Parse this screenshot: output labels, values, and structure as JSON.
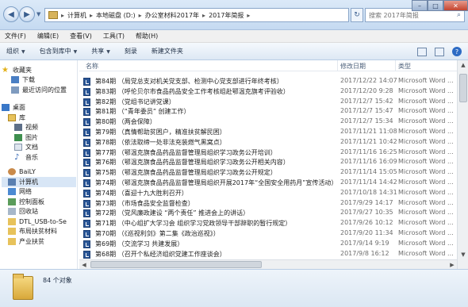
{
  "window": {
    "breadcrumbs": [
      "计算机",
      "本地磁盘 (D:)",
      "办公室材料2017年",
      "2017年简报"
    ],
    "search_placeholder": "搜索 2017年简报"
  },
  "menubar": [
    "文件(F)",
    "编辑(E)",
    "查看(V)",
    "工具(T)",
    "帮助(H)"
  ],
  "commandbar": {
    "organize": "组织",
    "include_in_library": "包含到库中",
    "share": "共享",
    "burn": "刻录",
    "new_folder": "新建文件夹"
  },
  "sidebar": {
    "favorites": {
      "label": "收藏夹",
      "items": [
        "下载",
        "最近访问的位置"
      ]
    },
    "desktop": "桌面",
    "libraries": {
      "label": "库",
      "items": [
        "视频",
        "图片",
        "文档",
        "音乐"
      ]
    },
    "baily": "BaiLY",
    "computer": "计算机",
    "network": "网络",
    "control_panel": "控制面板",
    "recycle_bin": "回收站",
    "extra": [
      "DTL_USB-to-Se",
      "布局扶贫材料",
      "产业扶贫"
    ]
  },
  "columns": {
    "name": "名称",
    "date": "修改日期",
    "type": "类型"
  },
  "files": [
    {
      "name": "第84期 （局党总支对机关党支部、检测中心党支部进行年终考核）",
      "date": "2017/12/22 14:07",
      "type": "Microsoft Word ..."
    },
    {
      "name": "第83期 （呼伦贝尔市食品药品安全工作考核组赴鄂温克旗考评验收）",
      "date": "2017/12/20 9:28",
      "type": "Microsoft Word ..."
    },
    {
      "name": "第82期 （党组书记讲党课）",
      "date": "2017/12/7 15:42",
      "type": "Microsoft Word ..."
    },
    {
      "name": "第81期 （“青年委员” 创建工作）",
      "date": "2017/12/7 15:47",
      "type": "Microsoft Word ..."
    },
    {
      "name": "第80期 （两会保障）",
      "date": "2017/12/7 15:34",
      "type": "Microsoft Word ..."
    },
    {
      "name": "第79期 （真情帮助贫困户，精准扶贫解民困）",
      "date": "2017/11/21 11:08",
      "type": "Microsoft Word ..."
    },
    {
      "name": "第78期 （依法取缔一处非法充装燃气黑窝点）",
      "date": "2017/11/21 10:42",
      "type": "Microsoft Word ..."
    },
    {
      "name": "第77期 （鄂温克旗食品药品监督管理局组织学习政务公开培训）",
      "date": "2017/11/16 16:25",
      "type": "Microsoft Word ..."
    },
    {
      "name": "第76期 （鄂温克旗食品药品监督管理局组织学习政务公开相关内容）",
      "date": "2017/11/16 16:09",
      "type": "Microsoft Word ..."
    },
    {
      "name": "第75期 （鄂温克旗食品药品监督管理局组织学习政务公开规定）",
      "date": "2017/11/14 15:05",
      "type": "Microsoft Word ..."
    },
    {
      "name": "第74期 （鄂温克旗食品药品监督管理局组织开展2017年“全国安全用药月”宣传活动）",
      "date": "2017/11/14 14:42",
      "type": "Microsoft Word ..."
    },
    {
      "name": "第74期 （喜迎十九大胜利召开）",
      "date": "2017/10/18 14:31",
      "type": "Microsoft Word ..."
    },
    {
      "name": "第73期 （市场食品安全监督检查）",
      "date": "2017/9/29 14:17",
      "type": "Microsoft Word ..."
    },
    {
      "name": "第72期 （党风廉政建设 “两个责任” 推进会上的讲话）",
      "date": "2017/9/27 10:35",
      "type": "Microsoft Word ..."
    },
    {
      "name": "第71期 （中心组扩大学习会 组织学习党政领导干部辞职的暂行规定）",
      "date": "2017/9/26 10:12",
      "type": "Microsoft Word ..."
    },
    {
      "name": "第70期 （《巡视利剑》第二集《政治巡视》）",
      "date": "2017/9/20 11:34",
      "type": "Microsoft Word ..."
    },
    {
      "name": "第69期 （交流学习 共建发展）",
      "date": "2017/9/14 9:19",
      "type": "Microsoft Word ..."
    },
    {
      "name": "第68期 （召开个私经济组织党建工作座谈会）",
      "date": "2017/9/8 16:12",
      "type": "Microsoft Word ..."
    }
  ],
  "status": {
    "count": "84 个对象"
  }
}
